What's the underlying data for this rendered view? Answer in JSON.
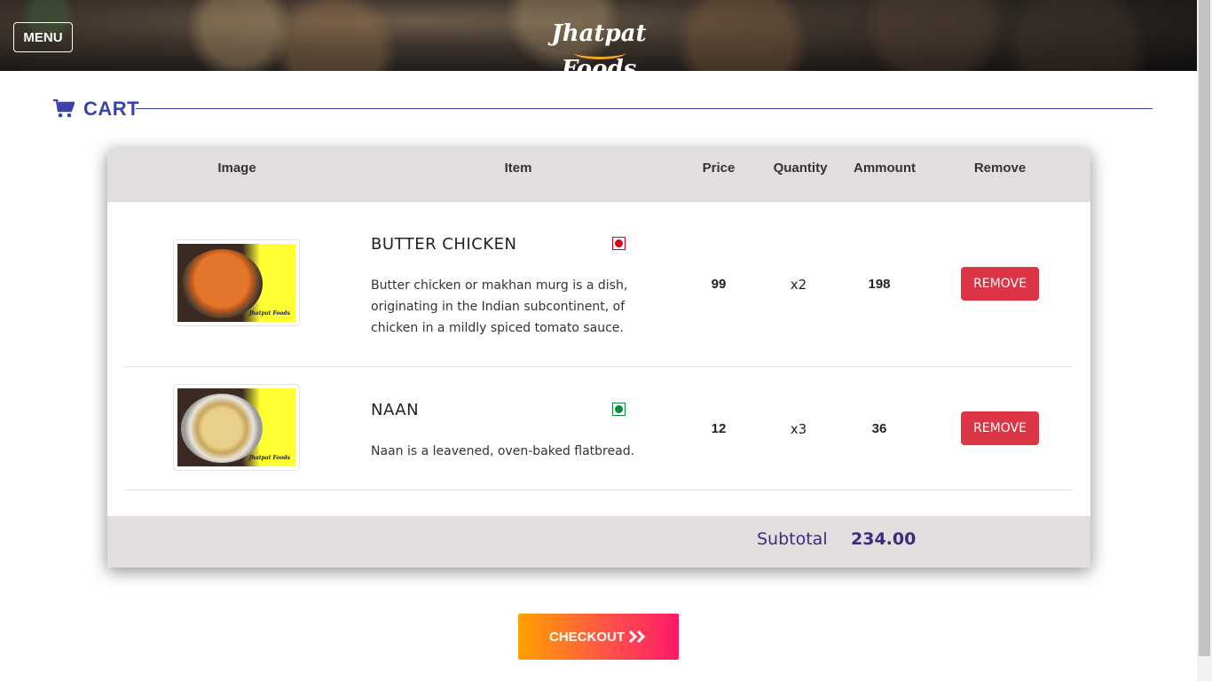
{
  "header": {
    "menu_label": "MENU",
    "brand": "Jhatpat Foods"
  },
  "cart": {
    "title": "CART",
    "icon": "shopping-cart-icon",
    "columns": [
      "Image",
      "Item",
      "Price",
      "Quantity",
      "Ammount",
      "Remove"
    ],
    "items": [
      {
        "name": "BUTTER CHICKEN",
        "description": "Butter chicken or makhan murg is a dish, originating in the Indian subcontinent, of chicken in a mildly spiced tomato sauce.",
        "diet": "non-veg",
        "diet_color": "#e0001b",
        "price": "99",
        "quantity": "x2",
        "amount": "198",
        "remove_label": "REMOVE",
        "image_brand": "Jhatpat Foods"
      },
      {
        "name": "NAAN",
        "description": "Naan is a leavened, oven-baked flatbread.",
        "diet": "veg",
        "diet_color": "#0b8a3c",
        "price": "12",
        "quantity": "x3",
        "amount": "36",
        "remove_label": "REMOVE",
        "image_brand": "Jhatpat Foods"
      }
    ],
    "subtotal_label": "Subtotal",
    "subtotal_value": "234.00"
  },
  "checkout": {
    "label": "CHECKOUT",
    "icon": "double-chevron-right-icon"
  },
  "colors": {
    "accent": "#3b44a8",
    "remove": "#dc3545",
    "header_bg": "#e3dede",
    "subtotal_text": "#3b2a80",
    "logo_swoosh": "#f4a71e",
    "checkout_gradient": [
      "#ffa100",
      "#ff1a66"
    ]
  }
}
